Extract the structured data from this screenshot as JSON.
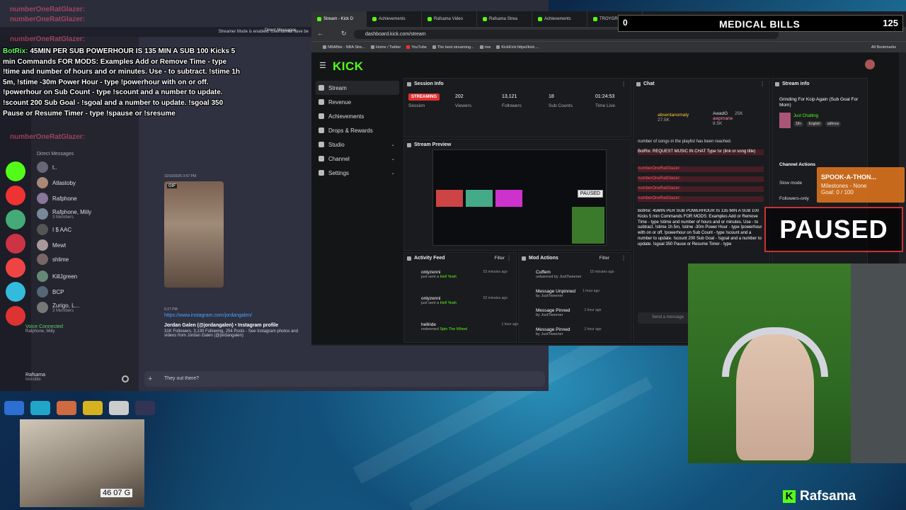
{
  "overlay": {
    "faded_name_1": "numberOneRatGlazer:",
    "faded_name_2": "numberOneRatGlazer:",
    "faded_name_3": "numberOneRatGlazer:",
    "bot_name": "BotRix:",
    "bot_message": "45MIN PER SUB POWERHOUR IS 135 MIN A SUB 100 Kicks 5 min Commands FOR MODS: Examples Add or Remove Time - type !time and number of hours and or minutes. Use - to subtract. !stime 1h 5m, !stime -30m Power Hour - type !powerhour with on or off. !powerhour on Sub Count - type !scount and a number to update. !scount 200 Sub Goal - !sgoal and a number to update. !sgoal 350 Pause or Resume Timer - type !spause or !sresume",
    "faded_name_4": "numberOneRatGlazer:"
  },
  "discord": {
    "streamer_mode": "Streamer Mode is enabled. Usernames have be",
    "direct_messages_tab": "Direct Messages",
    "dm_header": "Direct Messages",
    "dms": [
      {
        "name": "t..",
        "sub": ""
      },
      {
        "name": "Atlastoby",
        "sub": ""
      },
      {
        "name": "Rafphone",
        "sub": ""
      },
      {
        "name": "Rafphone, Miily",
        "sub": "3 Members"
      },
      {
        "name": "I $ AAC",
        "sub": ""
      },
      {
        "name": "Mewt",
        "sub": ""
      },
      {
        "name": "shlime",
        "sub": ""
      },
      {
        "name": "KillJgreen",
        "sub": ""
      },
      {
        "name": "BCP",
        "sub": ""
      },
      {
        "name": "Zurigo, L...",
        "sub": "3 Members"
      }
    ],
    "voice_title": "Voice Connected",
    "voice_sub": "Rafphone, Miily",
    "user_name": "Rafsama",
    "user_status": "Invisible",
    "msg1_time": "10/10/2025 3:57 PM",
    "gif_badge": "GIF",
    "msg2_time": "6:27 PM",
    "link": "https://www.instagram.com/jordangalen/",
    "embed_title": "Jordan Galen (@jordangalen) • Instagram profile",
    "embed_desc": "31K Followers, 3,130 Following, 254 Posts - See Instagram photos and videos from Jordan Galen (@jordangalen)",
    "input_text": "They out there?"
  },
  "browser": {
    "tabs": [
      "Stream - Kick D",
      "Achievements",
      "Rafsama Video",
      "Rafsama Strea",
      "Achievements",
      "TROYGRN"
    ],
    "url": "dashboard.kick.com/stream",
    "bookmarks": [
      "NBABite - NBA Stre...",
      "Home / Twitter",
      "YouTube",
      "The best streaming...",
      "rive",
      "KickKick:https//kick...."
    ],
    "all_bookmarks": "All Bookmarks"
  },
  "kick": {
    "logo": "KICK",
    "nav": [
      {
        "label": "Stream",
        "chevron": ""
      },
      {
        "label": "Revenue",
        "chevron": ""
      },
      {
        "label": "Achievements",
        "chevron": ""
      },
      {
        "label": "Drops & Rewards",
        "chevron": ""
      },
      {
        "label": "Studio",
        "chevron": "⌄"
      },
      {
        "label": "Channel",
        "chevron": "⌄"
      },
      {
        "label": "Settings",
        "chevron": "⌄"
      }
    ],
    "session": {
      "title": "Session Info",
      "status": "STREAMING",
      "status_label": "Session",
      "viewers": "202",
      "viewers_label": "Viewers",
      "followers": "13,121",
      "followers_label": "Followers",
      "subs": "18",
      "subs_label": "Sub Counts",
      "time": "01:24:53",
      "time_label": "Time Live"
    },
    "preview_title": "Stream Preview",
    "preview_paused": "PAUSED",
    "activity": {
      "title": "Activity Feed",
      "filter": "Filter",
      "items": [
        {
          "user": "onlyzenni",
          "action": "just sent a",
          "item": "Hell Yeah",
          "time": "53 minutes ago"
        },
        {
          "user": "onlyzenni",
          "action": "just sent a",
          "item": "Hell Yeah",
          "time": "53 minutes ago"
        },
        {
          "user": "hellride",
          "action": "redeemed",
          "item": "Spin The Wheel",
          "time": "1 hour ago"
        }
      ]
    },
    "mod": {
      "title": "Mod Actions",
      "filter": "Filter",
      "items": [
        {
          "action": "Cuffem",
          "sub": "unbanned by JustTweener",
          "time": "15 minutes ago"
        },
        {
          "action": "Message Unpinned",
          "sub": "by JustTweener",
          "time": "1 hour ago"
        },
        {
          "action": "Message Pinned",
          "sub": "by JustTweener",
          "time": "1 hour ago"
        },
        {
          "action": "Message Pinned",
          "sub": "by JustTweener",
          "time": "1 hour ago"
        }
      ]
    },
    "chat": {
      "title": "Chat",
      "user1": "absentanomaly",
      "user1_count": "27.5K",
      "user2": "AwadG",
      "user2_count": "25K",
      "user3": "awpmane",
      "user3_count": "8.5K",
      "lines": [
        "number of songs in the playlist has been reached.",
        "BotRix: REQUEST MUSIC IN CHAT Type !sr (link or song title)",
        "numberOneRatGlazer:",
        "numberOneRatGlazer:",
        "numberOneRatGlazer:",
        "numberOneRatGlazer:",
        "BotRix: 45MIN PER SUB POWERHOUR IS 135 MIN A SUB 100 Kicks 5 min Commands FOR MODS: Examples Add or Remove Time - type !stime and number of hours and or minutes. Use - to subtract. !stime 1h 5m, !stime -30m Power Hour - type !powerhour with on or off. !powerhour on Sub Count - type !scount and a number to update. !scount 200 Sub Goal - !sgoal and a number to update. !sgoal 350 Pause or Resume Timer - type"
      ],
      "send_placeholder": "Send a message"
    },
    "streaminfo": {
      "title": "Stream info",
      "stream_title": "Grinding For Kcip Again (Sub Goal For Mom)",
      "category": "Just Chatting",
      "tags": [
        "18+",
        "English",
        "adhnos"
      ],
      "channel_actions": "Channel Actions",
      "slow_mode": "Slow mode",
      "followers_only": "Followers-only"
    }
  },
  "widgets": {
    "medical_count": "0",
    "medical_label": "MEDICAL BILLS",
    "medical_goal": "125",
    "paused": "PAUSED",
    "spook_title": "SPOOK-A-THON...",
    "spook_milestones": "Milestones - None",
    "spook_goal": "Goal: 0 / 100",
    "streamer_name": "Rafsama",
    "kid_plate": "46 07 G"
  },
  "colors": {
    "kick_green": "#53fc18",
    "streaming_red": "#e0312f",
    "link_blue": "#4aa3ff"
  }
}
